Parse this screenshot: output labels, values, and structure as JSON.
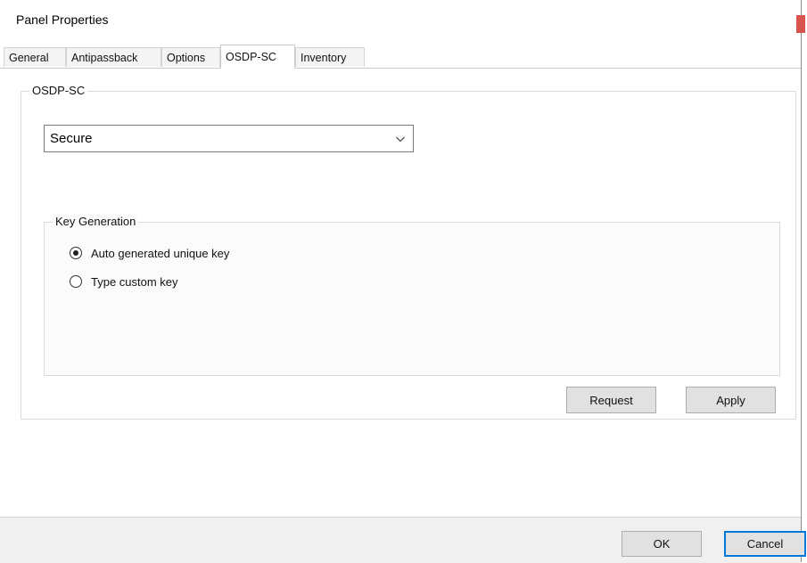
{
  "window": {
    "title": "Panel Properties"
  },
  "tabs": [
    {
      "label": "General"
    },
    {
      "label": "Antipassback"
    },
    {
      "label": "Options"
    },
    {
      "label": "OSDP-SC"
    },
    {
      "label": "Inventory"
    }
  ],
  "active_tab": "OSDP-SC",
  "osdp_group": {
    "legend": "OSDP-SC",
    "mode_select": {
      "value": "Secure"
    }
  },
  "key_generation": {
    "legend": "Key Generation",
    "options": [
      {
        "label": "Auto generated unique key",
        "checked": true
      },
      {
        "label": "Type custom key",
        "checked": false
      }
    ]
  },
  "actions": {
    "request_label": "Request",
    "apply_label": "Apply"
  },
  "footer": {
    "ok_label": "OK",
    "cancel_label": "Cancel"
  },
  "colors": {
    "close_button": "#d9534f",
    "default_button_border": "#0078d7",
    "footer_bg": "#f0f0f0"
  }
}
